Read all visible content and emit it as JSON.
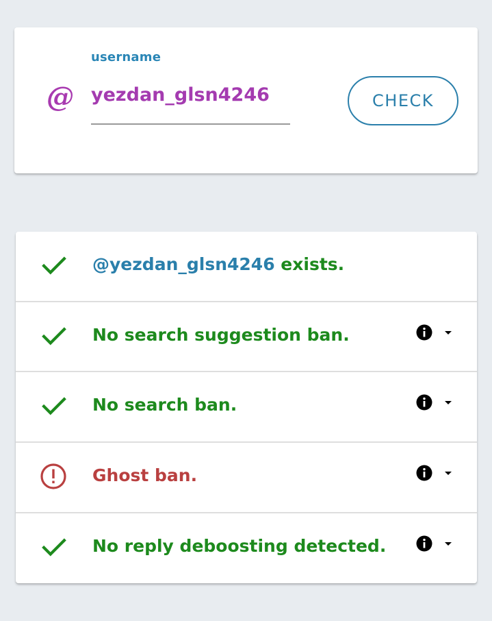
{
  "search": {
    "label": "username",
    "value": "yezdan_glsn4246",
    "button_label": "CHECK",
    "icon": "at-icon"
  },
  "results": {
    "exists": {
      "handle": "@yezdan_glsn4246",
      "text": " exists.",
      "status": "ok"
    },
    "items": [
      {
        "text": "No search suggestion ban.",
        "status": "ok"
      },
      {
        "text": "No search ban.",
        "status": "ok"
      },
      {
        "text": "Ghost ban.",
        "status": "warning"
      },
      {
        "text": "No reply deboosting detected.",
        "status": "ok"
      }
    ]
  },
  "colors": {
    "accent_blue": "#2a7fab",
    "username_purple": "#a43bb0",
    "ok_green": "#1d8a1d",
    "warning_red": "#b94040",
    "background": "#e8ecf0"
  }
}
